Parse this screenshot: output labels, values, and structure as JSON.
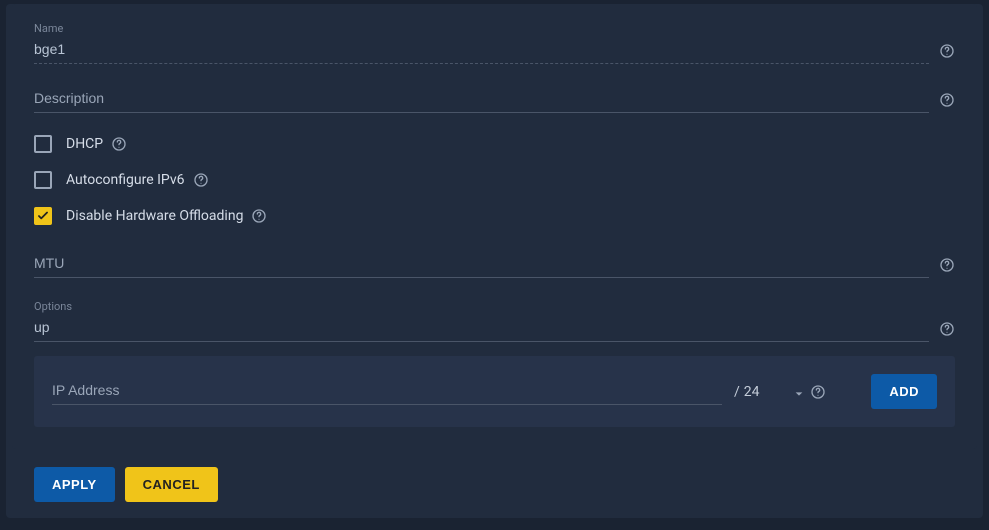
{
  "fields": {
    "name": {
      "label": "Name",
      "value": "bge1"
    },
    "description": {
      "placeholder": "Description",
      "value": ""
    },
    "mtu": {
      "placeholder": "MTU",
      "value": ""
    },
    "options": {
      "label": "Options",
      "value": "up"
    }
  },
  "checkboxes": {
    "dhcp": {
      "label": "DHCP",
      "checked": false
    },
    "autoconf6": {
      "label": "Autoconfigure IPv6",
      "checked": false
    },
    "hwoffload": {
      "label": "Disable Hardware Offloading",
      "checked": true
    }
  },
  "ip": {
    "placeholder": "IP Address",
    "value": "",
    "prefix": "24",
    "slash": "/",
    "add_label": "ADD"
  },
  "buttons": {
    "apply": "APPLY",
    "cancel": "CANCEL"
  }
}
